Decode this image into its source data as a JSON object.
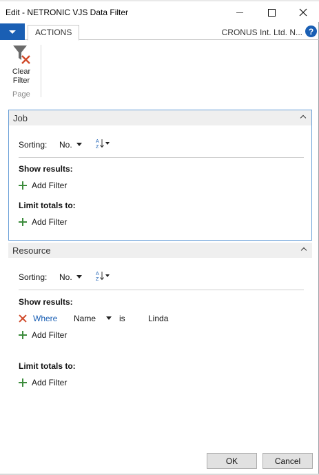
{
  "window": {
    "title": "Edit - NETRONIC VJS Data Filter",
    "controls": {
      "minimize": "minimize",
      "maximize": "maximize",
      "close": "close"
    }
  },
  "ribbon": {
    "tab_actions": "ACTIONS",
    "company": "CRONUS Int. Ltd. N...",
    "help": "?",
    "clear_filter_line1": "Clear",
    "clear_filter_line2": "Filter",
    "group_label": "Page"
  },
  "job": {
    "title": "Job",
    "sorting_label": "Sorting:",
    "sorting_value": "No.",
    "show_results_label": "Show results:",
    "add_filter_1": "Add Filter",
    "limit_totals_label": "Limit totals to:",
    "add_filter_2": "Add Filter"
  },
  "resource": {
    "title": "Resource",
    "sorting_label": "Sorting:",
    "sorting_value": "No.",
    "show_results_label": "Show results:",
    "filter": {
      "where": "Where",
      "field": "Name",
      "operator": "is",
      "value": "Linda"
    },
    "add_filter_1": "Add Filter",
    "limit_totals_label": "Limit totals to:",
    "add_filter_2": "Add Filter"
  },
  "footer": {
    "ok": "OK",
    "cancel": "Cancel"
  },
  "colors": {
    "accent": "#1a5fb4",
    "plus": "#3c8c3c",
    "remove": "#d04a2a",
    "panel_border": "#6aa0d8"
  },
  "icons": [
    "chevron-up-icon",
    "plus-icon",
    "remove-x-icon",
    "sort-az-icon",
    "filter-clear-icon",
    "help-icon"
  ]
}
